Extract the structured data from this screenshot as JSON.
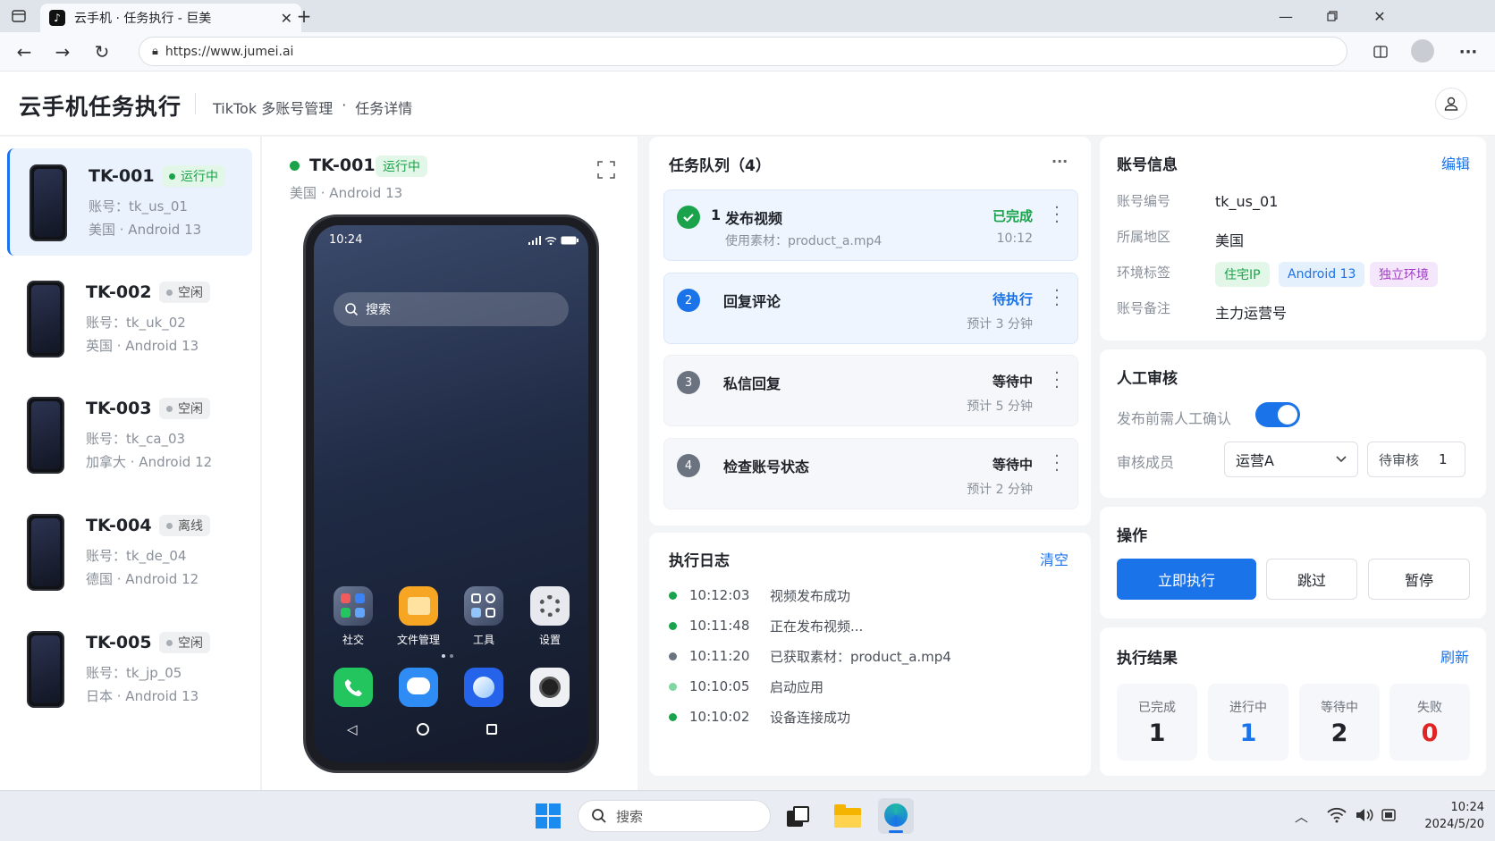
{
  "browser": {
    "tab_title": "云手机 · 任务执行 - 巨美",
    "url": "https://www.jumei.ai"
  },
  "header": {
    "title": "云手机任务执行",
    "breadcrumb_1": "TikTok 多账号管理",
    "breadcrumb_sep": "·",
    "breadcrumb_2": "任务详情"
  },
  "devices": [
    {
      "name": "TK-001",
      "status": "运行中",
      "account": "账号：tk_us_01",
      "region": "美国 · Android 13"
    },
    {
      "name": "TK-002",
      "status": "空闲",
      "account": "账号：tk_uk_02",
      "region": "英国 · Android 13"
    },
    {
      "name": "TK-003",
      "status": "空闲",
      "account": "账号：tk_ca_03",
      "region": "加拿大 · Android 12"
    },
    {
      "name": "TK-004",
      "status": "离线",
      "account": "账号：tk_de_04",
      "region": "德国 · Android 12"
    },
    {
      "name": "TK-005",
      "status": "空闲",
      "account": "账号：tk_jp_05",
      "region": "日本 · Android 13"
    }
  ],
  "preview": {
    "name": "TK-001",
    "status": "运行中",
    "sub": "美国 · Android 13",
    "time": "10:24",
    "search_placeholder": "搜索",
    "apps": [
      "社交",
      "文件管理",
      "工具",
      "设置"
    ]
  },
  "queue": {
    "title": "任务队列（4）",
    "more": "···",
    "tasks": [
      {
        "num": "1",
        "title": "发布视频",
        "sub": "使用素材：product_a.mp4",
        "status": "已完成",
        "meta": "10:12"
      },
      {
        "num": "2",
        "title": "回复评论",
        "status": "待执行",
        "meta": "预计 3 分钟"
      },
      {
        "num": "3",
        "title": "私信回复",
        "status": "等待中",
        "meta": "预计 5 分钟"
      },
      {
        "num": "4",
        "title": "检查账号状态",
        "status": "等待中",
        "meta": "预计 2 分钟"
      }
    ]
  },
  "log": {
    "title": "执行日志",
    "clear": "清空",
    "rows": [
      {
        "time": "10:12:03",
        "text": "视频发布成功"
      },
      {
        "time": "10:11:48",
        "text": "正在发布视频..."
      },
      {
        "time": "10:11:20",
        "text": "已获取素材：product_a.mp4"
      },
      {
        "time": "10:10:05",
        "text": "启动应用"
      },
      {
        "time": "10:10:02",
        "text": "设备连接成功"
      }
    ]
  },
  "account": {
    "title": "账号信息",
    "edit": "编辑",
    "id_label": "账号编号",
    "id": "tk_us_01",
    "region_label": "所属地区",
    "region": "美国",
    "tags_label": "环境标签",
    "tags": [
      "住宅IP",
      "Android 13",
      "独立环境"
    ],
    "note_label": "账号备注",
    "note": "主力运营号"
  },
  "review": {
    "title": "人工审核",
    "confirm_label": "发布前需人工确认",
    "toggle_on": true,
    "member_label": "审核成员",
    "member": "运营A",
    "pending_label": "待审核",
    "pending": "1"
  },
  "actions": {
    "title": "操作",
    "run": "立即执行",
    "skip": "跳过",
    "pause": "暂停"
  },
  "results": {
    "title": "执行结果",
    "refresh": "刷新",
    "items": [
      {
        "label": "已完成",
        "value": "1",
        "color": "#1f2329"
      },
      {
        "label": "进行中",
        "value": "1",
        "color": "#1a73e8"
      },
      {
        "label": "等待中",
        "value": "2",
        "color": "#1f2329"
      },
      {
        "label": "失败",
        "value": "0",
        "color": "#e02424"
      }
    ]
  },
  "taskbar": {
    "search": "搜索",
    "time": "10:24",
    "date": "2024/5/20"
  },
  "colors": {
    "accent": "#1a73e8",
    "success": "#1aa34a",
    "danger": "#e02424"
  }
}
